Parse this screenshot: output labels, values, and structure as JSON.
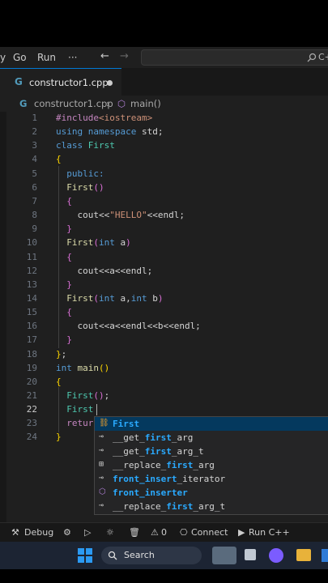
{
  "menu": {
    "items": [
      "Go",
      "Run"
    ],
    "more": "···",
    "search_tail": "C+"
  },
  "tab": {
    "filename": "constructor1.cpp"
  },
  "breadcrumb": {
    "file": "constructor1.cpp",
    "symbol": "main()"
  },
  "editor": {
    "active_line": 22,
    "lines": [
      {
        "n": "1"
      },
      {
        "n": "2"
      },
      {
        "n": "3"
      },
      {
        "n": "4"
      },
      {
        "n": "5"
      },
      {
        "n": "6"
      },
      {
        "n": "7"
      },
      {
        "n": "8"
      },
      {
        "n": "9"
      },
      {
        "n": "10"
      },
      {
        "n": "11"
      },
      {
        "n": "12"
      },
      {
        "n": "13"
      },
      {
        "n": "14"
      },
      {
        "n": "15"
      },
      {
        "n": "16"
      },
      {
        "n": "17"
      },
      {
        "n": "18"
      },
      {
        "n": "19"
      },
      {
        "n": "20"
      },
      {
        "n": "21"
      },
      {
        "n": "22"
      },
      {
        "n": "23"
      },
      {
        "n": "24"
      }
    ],
    "code": [
      [
        [
          "pp",
          "#include"
        ],
        [
          "inc",
          "<iostream>"
        ]
      ],
      [
        [
          "kw",
          "using"
        ],
        [
          "",
          ""
        ],
        [
          "kw",
          " namespace"
        ],
        [
          "",
          " std;"
        ]
      ],
      [
        [
          "kw",
          "class"
        ],
        [
          "ty",
          " First"
        ]
      ],
      [
        [
          "br2",
          "{"
        ]
      ],
      [
        [
          "kw",
          "  public:"
        ]
      ],
      [
        [
          "fn",
          "  First"
        ],
        [
          "br",
          "()"
        ]
      ],
      [
        [
          "br",
          "  {"
        ]
      ],
      [
        [
          "",
          "    cout<<"
        ],
        [
          "str",
          "\"HELLO\""
        ],
        [
          "",
          "<<endl;"
        ]
      ],
      [
        [
          "br",
          "  }"
        ]
      ],
      [
        [
          "fn",
          "  First"
        ],
        [
          "br",
          "("
        ],
        [
          "kw",
          "int"
        ],
        [
          "",
          " a"
        ],
        [
          "br",
          ")"
        ]
      ],
      [
        [
          "br",
          "  {"
        ]
      ],
      [
        [
          "",
          "    cout<<a<<endl;"
        ]
      ],
      [
        [
          "br",
          "  }"
        ]
      ],
      [
        [
          "fn",
          "  First"
        ],
        [
          "br",
          "("
        ],
        [
          "kw",
          "int"
        ],
        [
          "",
          " a,"
        ],
        [
          "kw",
          "int"
        ],
        [
          "",
          " b"
        ],
        [
          "br",
          ")"
        ]
      ],
      [
        [
          "br",
          "  {"
        ]
      ],
      [
        [
          "",
          "    cout<<a<<endl<<b<<endl;"
        ]
      ],
      [
        [
          "br",
          "  }"
        ]
      ],
      [
        [
          "br2",
          "}"
        ],
        [
          "",
          ";"
        ]
      ],
      [
        [
          "kw",
          "int"
        ],
        [
          "fn",
          " main"
        ],
        [
          "br2",
          "()"
        ]
      ],
      [
        [
          "br2",
          "{"
        ]
      ],
      [
        [
          "ty",
          "  First"
        ],
        [
          "br",
          "()"
        ],
        [
          "",
          ";"
        ]
      ],
      [
        [
          "ty",
          "  First"
        ]
      ],
      [
        [
          "pp",
          "  retur"
        ]
      ],
      [
        [
          "br2",
          "}"
        ]
      ]
    ]
  },
  "suggestions": [
    {
      "icon": "class",
      "pre": "",
      "match": "First",
      "post": "",
      "selected": true
    },
    {
      "icon": "field",
      "pre": "__get_",
      "match": "first",
      "post": "_arg",
      "selected": false
    },
    {
      "icon": "field",
      "pre": "__get_",
      "match": "first",
      "post": "_arg_t",
      "selected": false
    },
    {
      "icon": "struct",
      "pre": "__replace_",
      "match": "first",
      "post": "_arg",
      "selected": false
    },
    {
      "icon": "field",
      "pre": "",
      "match": "front_insert",
      "post": "_iterator",
      "selected": false
    },
    {
      "icon": "function",
      "pre": "",
      "match": "front_inserter",
      "post": "",
      "selected": false
    },
    {
      "icon": "field",
      "pre": "__replace_",
      "match": "first",
      "post": "_arg_t",
      "selected": false
    }
  ],
  "status": {
    "debug": "Debug",
    "count": "0",
    "connect": "Connect",
    "run": "Run C++"
  },
  "taskbar": {
    "search": "Search"
  },
  "colors": {
    "accent": "#0078d4",
    "keyword": "#569cd6",
    "type": "#4ec9b0",
    "function": "#dcdcaa",
    "string": "#ce9178"
  }
}
